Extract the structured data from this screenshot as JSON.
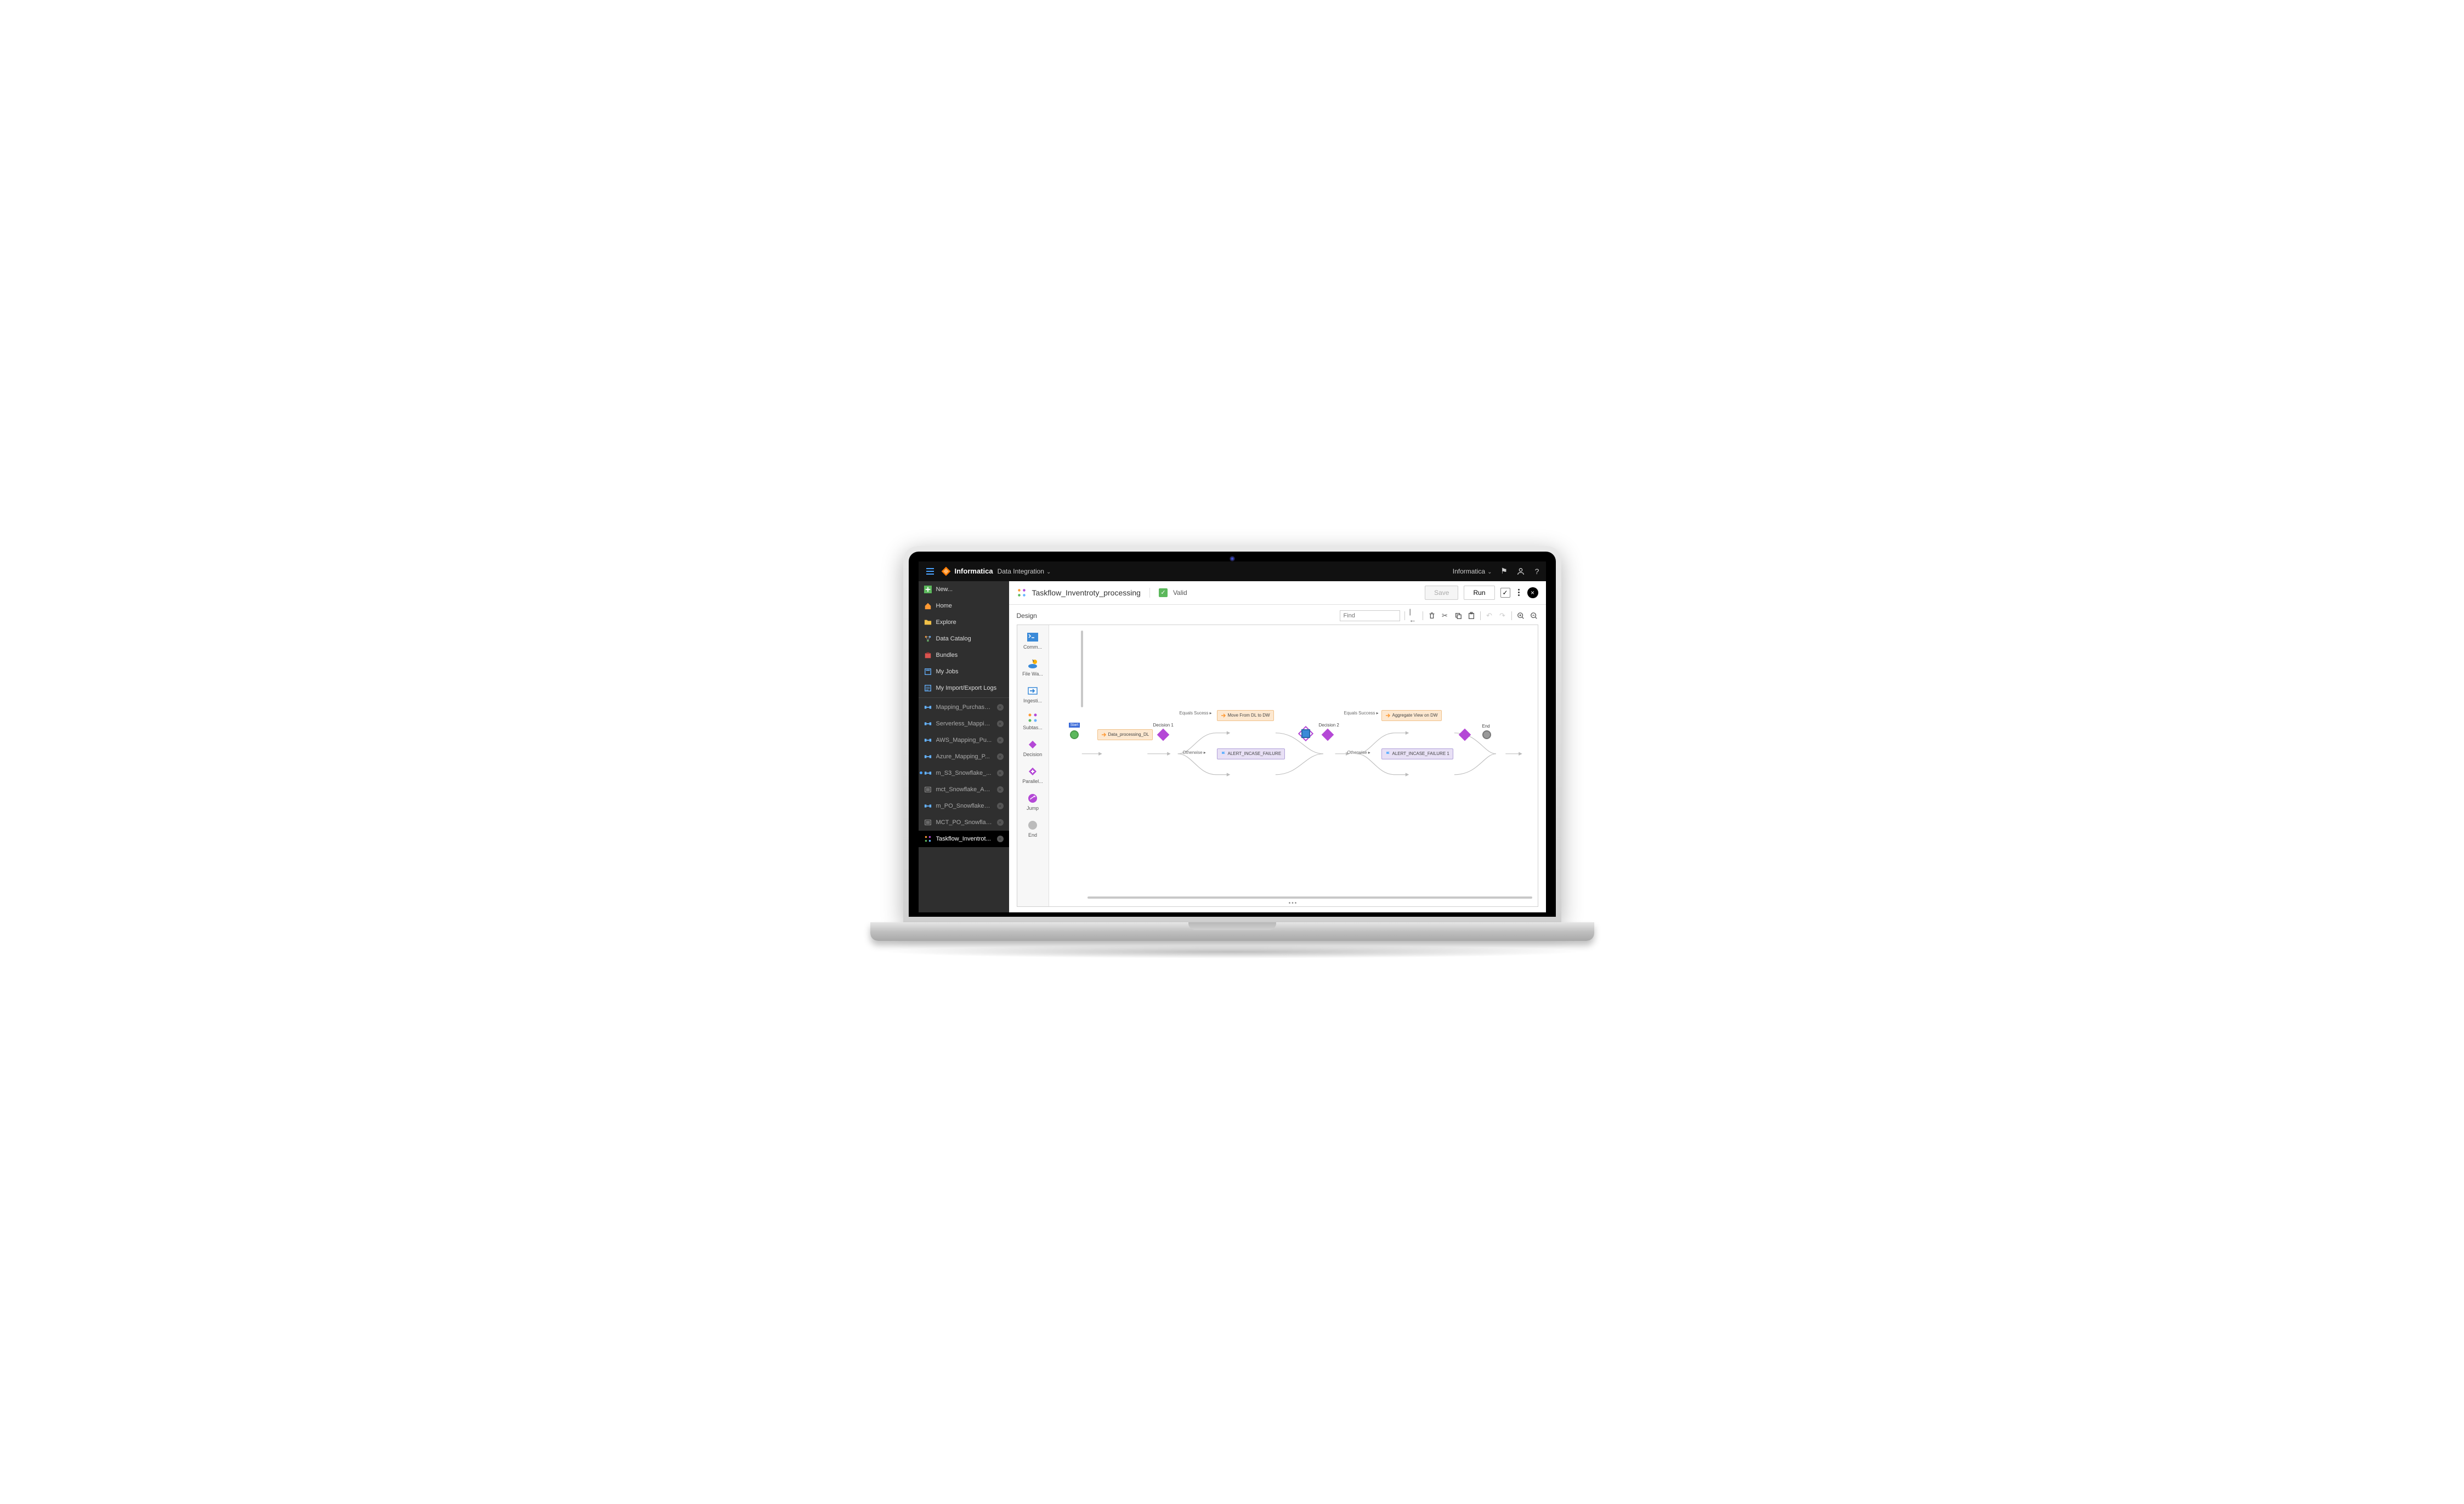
{
  "topbar": {
    "brand": "Informatica",
    "product": "Data Integration",
    "org_label": "Informatica"
  },
  "sidebar": {
    "new_label": "New...",
    "nav": [
      {
        "label": "Home",
        "icon": "home"
      },
      {
        "label": "Explore",
        "icon": "folder"
      },
      {
        "label": "Data Catalog",
        "icon": "catalog"
      },
      {
        "label": "Bundles",
        "icon": "bundle"
      },
      {
        "label": "My Jobs",
        "icon": "jobs"
      },
      {
        "label": "My Import/Export Logs",
        "icon": "logs"
      }
    ],
    "tabs": [
      {
        "label": "Mapping_Purchase...",
        "icon": "mapping"
      },
      {
        "label": "Serverless_Mappin...",
        "icon": "mapping"
      },
      {
        "label": "AWS_Mapping_Pu...",
        "icon": "mapping"
      },
      {
        "label": "Azure_Mapping_P...",
        "icon": "mapping"
      },
      {
        "label": "m_S3_Snowflake_...",
        "icon": "mapping",
        "status": true
      },
      {
        "label": "mct_Snowflake_Ad...",
        "icon": "mct"
      },
      {
        "label": "m_PO_Snowflake_...",
        "icon": "mapping"
      },
      {
        "label": "MCT_PO_Snowflak...",
        "icon": "mct"
      },
      {
        "label": "Taskflow_Inventrot...",
        "icon": "taskflow",
        "active": true
      }
    ]
  },
  "header": {
    "title": "Taskflow_Inventroty_processing",
    "valid_label": "Valid",
    "save_label": "Save",
    "run_label": "Run"
  },
  "design": {
    "label": "Design",
    "find_placeholder": "Find"
  },
  "palette": [
    {
      "label": "Comm...",
      "icon": "command"
    },
    {
      "label": "File Wa...",
      "icon": "filewatch"
    },
    {
      "label": "Ingesti...",
      "icon": "ingest"
    },
    {
      "label": "Subtas...",
      "icon": "subtask"
    },
    {
      "label": "Decision",
      "icon": "decision"
    },
    {
      "label": "Parallel...",
      "icon": "parallel"
    },
    {
      "label": "Jump",
      "icon": "jump"
    },
    {
      "label": "End",
      "icon": "end"
    }
  ],
  "flow": {
    "start_label": "Start",
    "end_label": "End",
    "nodes": {
      "data_processing": "Data_processing_DL",
      "decision1": "Decision 1",
      "move_dl_dw": "Move From DL to DW",
      "alert1": "ALERT_INCASE_FAILURE",
      "decision2": "Decision 2",
      "aggregate": "Aggregate View on DW",
      "alert2": "ALERT_INCASE_FAILURE 1"
    },
    "edges": {
      "equals_success": "Equals Sucess",
      "otherwise": "Otherwise",
      "equals_success2": "Equals Success",
      "otherwise2": "Otherwise"
    }
  }
}
